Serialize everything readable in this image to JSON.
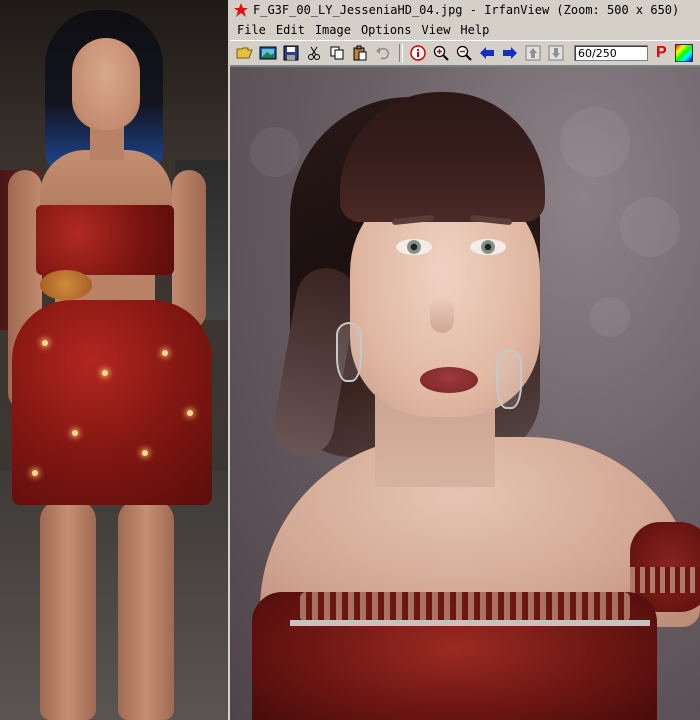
{
  "window": {
    "title": "F_G3F_00_LY_JesseniaHD_04.jpg - IrfanView (Zoom: 500 x 650)"
  },
  "menu": {
    "items": [
      "File",
      "Edit",
      "Image",
      "Options",
      "View",
      "Help"
    ]
  },
  "toolbar": {
    "page_field_value": "60/250",
    "p_label": "P",
    "icons": [
      "open-folder-icon",
      "slideshow-icon",
      "save-icon",
      "cut-icon",
      "copy-icon",
      "paste-icon",
      "undo-icon",
      "info-icon",
      "zoom-in-icon",
      "zoom-out-icon",
      "previous-arrow-icon",
      "next-arrow-icon",
      "first-file-icon",
      "last-file-icon",
      "paint-icon",
      "color-palette-icon"
    ]
  },
  "colors": {
    "window_bg": "#d4d0c8",
    "p_icon": "#e00000",
    "arrow_blue": "#1030c0",
    "info_red": "#d00000"
  }
}
